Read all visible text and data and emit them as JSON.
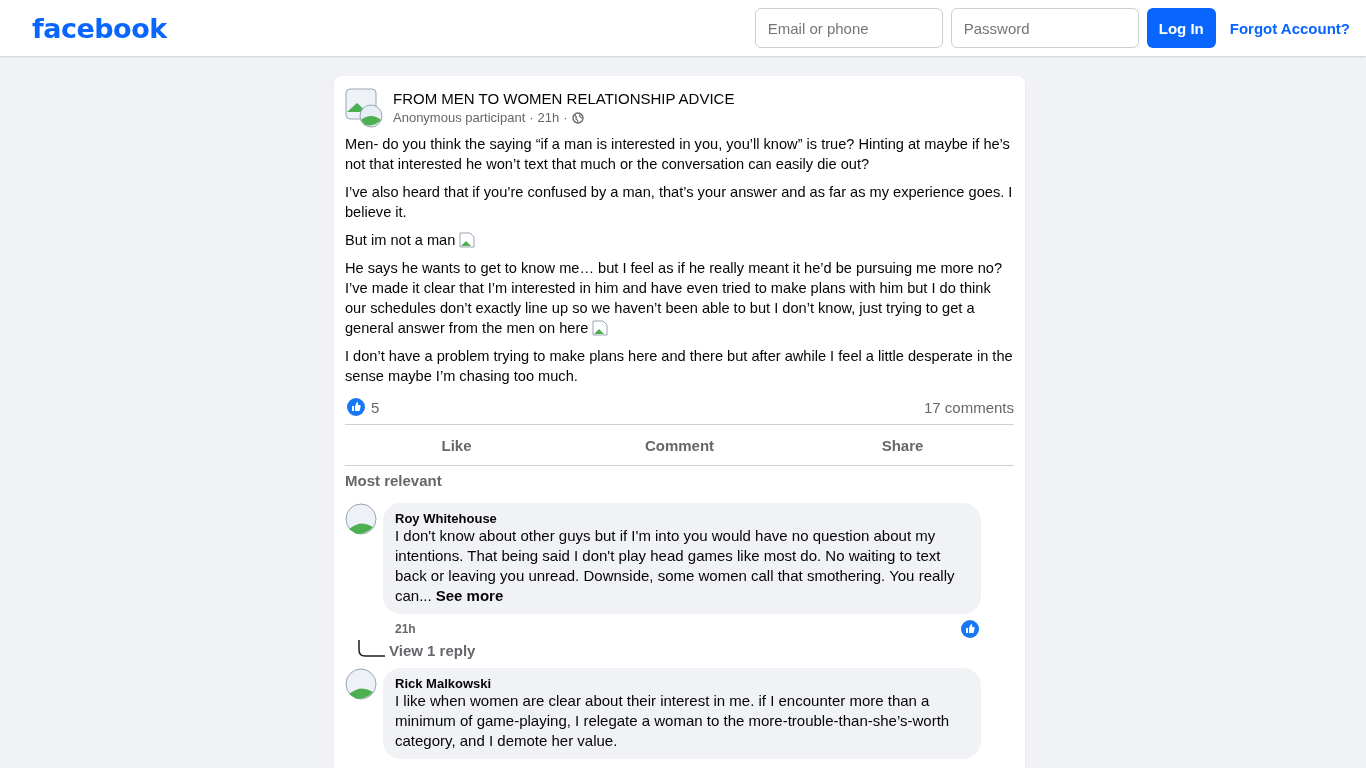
{
  "header": {
    "logo": "facebook",
    "email_placeholder": "Email or phone",
    "password_placeholder": "Password",
    "login": "Log In",
    "forgot": "Forgot Account?"
  },
  "post": {
    "group": "FROM MEN TO WOMEN RELATIONSHIP ADVICE",
    "author": "Anonymous participant",
    "time": "21h",
    "separator": "·",
    "paragraphs": [
      {
        "text": "Men- do you think the saying “if a man is interested in you, you’ll know” is true? Hinting at maybe if he’s not that interested he won’t text that much or the conversation can easily die out?",
        "inline_image": false
      },
      {
        "text": "I’ve also heard that if you’re confused by a man, that’s your answer and as far as my experience goes. I believe it.",
        "inline_image": false
      },
      {
        "text": "But im not a man",
        "inline_image": true
      },
      {
        "text": "He says he wants to get to know me… but I feel as if he really meant it he’d be pursuing me more no? I’ve made it clear that I’m interested in him and have even tried to make plans with him but I do think our schedules don’t exactly line up so we haven’t been able to but I don’t know, just trying to get a general answer from the men on here",
        "inline_image": true
      },
      {
        "text": "I don’t have a problem trying to make plans here and there but after awhile I feel a little desperate in the sense maybe I’m chasing too much.",
        "inline_image": false
      }
    ],
    "reactions": "5",
    "comments_count": "17 comments",
    "actions": [
      "Like",
      "Comment",
      "Share"
    ],
    "sort": "Most relevant",
    "comments": [
      {
        "name": "Roy Whitehouse",
        "text": "I don't know about other guys but if I'm into you would have no question about my intentions. That being said I don't play head games like most do. No waiting to text back or leaving you unread. Downside, some women call that smothering. You really can...",
        "see_more": "See more",
        "time": "21h",
        "liked": true,
        "replies": "View 1 reply"
      },
      {
        "name": "Rick Malkowski",
        "text": "I like when women are clear about their interest in me. if I encounter more than a minimum of game-playing, I relegate a woman to the more-trouble-than-she’s-worth category, and I demote her value."
      }
    ]
  }
}
